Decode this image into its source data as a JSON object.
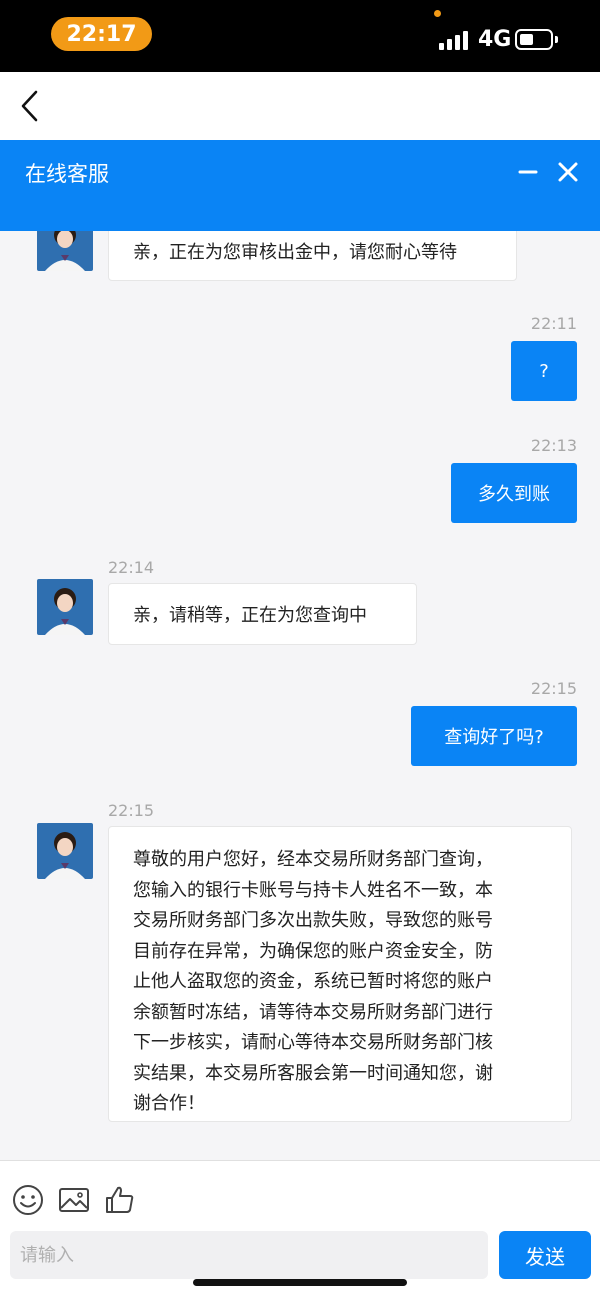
{
  "status_bar": {
    "time": "22:17",
    "network": "4G",
    "battery_level": 0.35
  },
  "header": {
    "title": "在线客服"
  },
  "messages": [
    {
      "from": "agent",
      "text": "亲，正在为您审核出金中，请您耐心等待"
    },
    {
      "from": "user",
      "time": "22:11",
      "text": "?"
    },
    {
      "from": "user",
      "time": "22:13",
      "text": "多久到账"
    },
    {
      "from": "agent",
      "time": "22:14",
      "text": "亲，请稍等，正在为您查询中"
    },
    {
      "from": "user",
      "time": "22:15",
      "text": "查询好了吗?"
    },
    {
      "from": "agent",
      "time": "22:15",
      "lines": [
        "尊敬的用户您好，经本交易所财务部门查询，",
        "您输入的银行卡账号与持卡人姓名不一致，本",
        "交易所财务部门多次出款失败，导致您的账号",
        "目前存在异常，为确保您的账户资金安全，防",
        "止他人盗取您的资金，系统已暂时将您的账户",
        "余额暂时冻结，请等待本交易所财务部门进行",
        "下一步核实，请耐心等待本交易所财务部门核",
        "实结果，本交易所客服会第一时间通知您，谢",
        "谢合作！"
      ]
    }
  ],
  "footer": {
    "input_placeholder": "请输入",
    "send_label": "发送"
  },
  "colors": {
    "accent": "#0a84f5",
    "time_pill": "#f29a16"
  },
  "icons": [
    "back-icon",
    "minimize-icon",
    "close-icon",
    "emoji-icon",
    "image-icon",
    "thumbs-up-icon"
  ]
}
